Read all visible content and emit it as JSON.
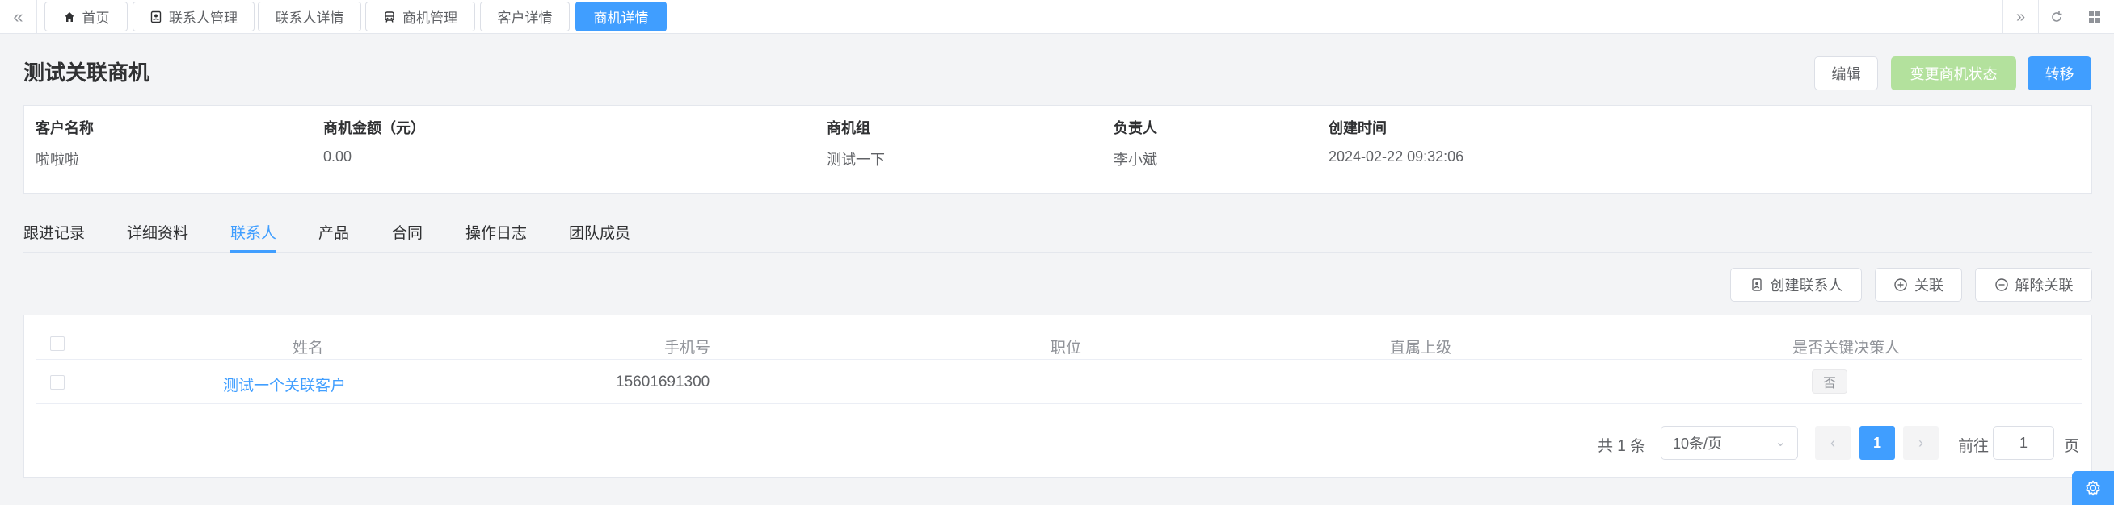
{
  "tags": [
    {
      "label": "首页",
      "icon": "home-icon"
    },
    {
      "label": "联系人管理",
      "icon": "contact-card-icon"
    },
    {
      "label": "联系人详情",
      "icon": ""
    },
    {
      "label": "商机管理",
      "icon": "vehicle-icon"
    },
    {
      "label": "客户详情",
      "icon": ""
    },
    {
      "label": "商机详情",
      "icon": "",
      "active": true
    }
  ],
  "header": {
    "title": "测试关联商机",
    "edit_label": "编辑",
    "change_status_label": "变更商机状态",
    "transfer_label": "转移"
  },
  "summary": {
    "customer_label": "客户名称",
    "customer_value": "啦啦啦",
    "amount_label": "商机金额（元）",
    "amount_value": "0.00",
    "group_label": "商机组",
    "group_value": "测试一下",
    "owner_label": "负责人",
    "owner_value": "李小斌",
    "created_label": "创建时间",
    "created_value": "2024-02-22 09:32:06"
  },
  "tabs": [
    "跟进记录",
    "详细资料",
    "联系人",
    "产品",
    "合同",
    "操作日志",
    "团队成员"
  ],
  "active_tab": "联系人",
  "actions": {
    "create_contact": "创建联系人",
    "link": "关联",
    "unlink": "解除关联"
  },
  "table": {
    "columns": [
      "姓名",
      "手机号",
      "职位",
      "直属上级",
      "是否关键决策人"
    ],
    "rows": [
      {
        "name": "测试一个关联客户",
        "phone": "15601691300",
        "position": "",
        "superior": "",
        "key_decision": "否"
      }
    ]
  },
  "pagination": {
    "total": "共 1 条",
    "page_size": "10条/页",
    "current_page": "1",
    "goto_prefix": "前往",
    "goto_value": "1",
    "goto_suffix": "页"
  },
  "colors": {
    "primary": "#409eff",
    "disabled_success": "#b3e19d",
    "background": "#f3f4f6"
  }
}
